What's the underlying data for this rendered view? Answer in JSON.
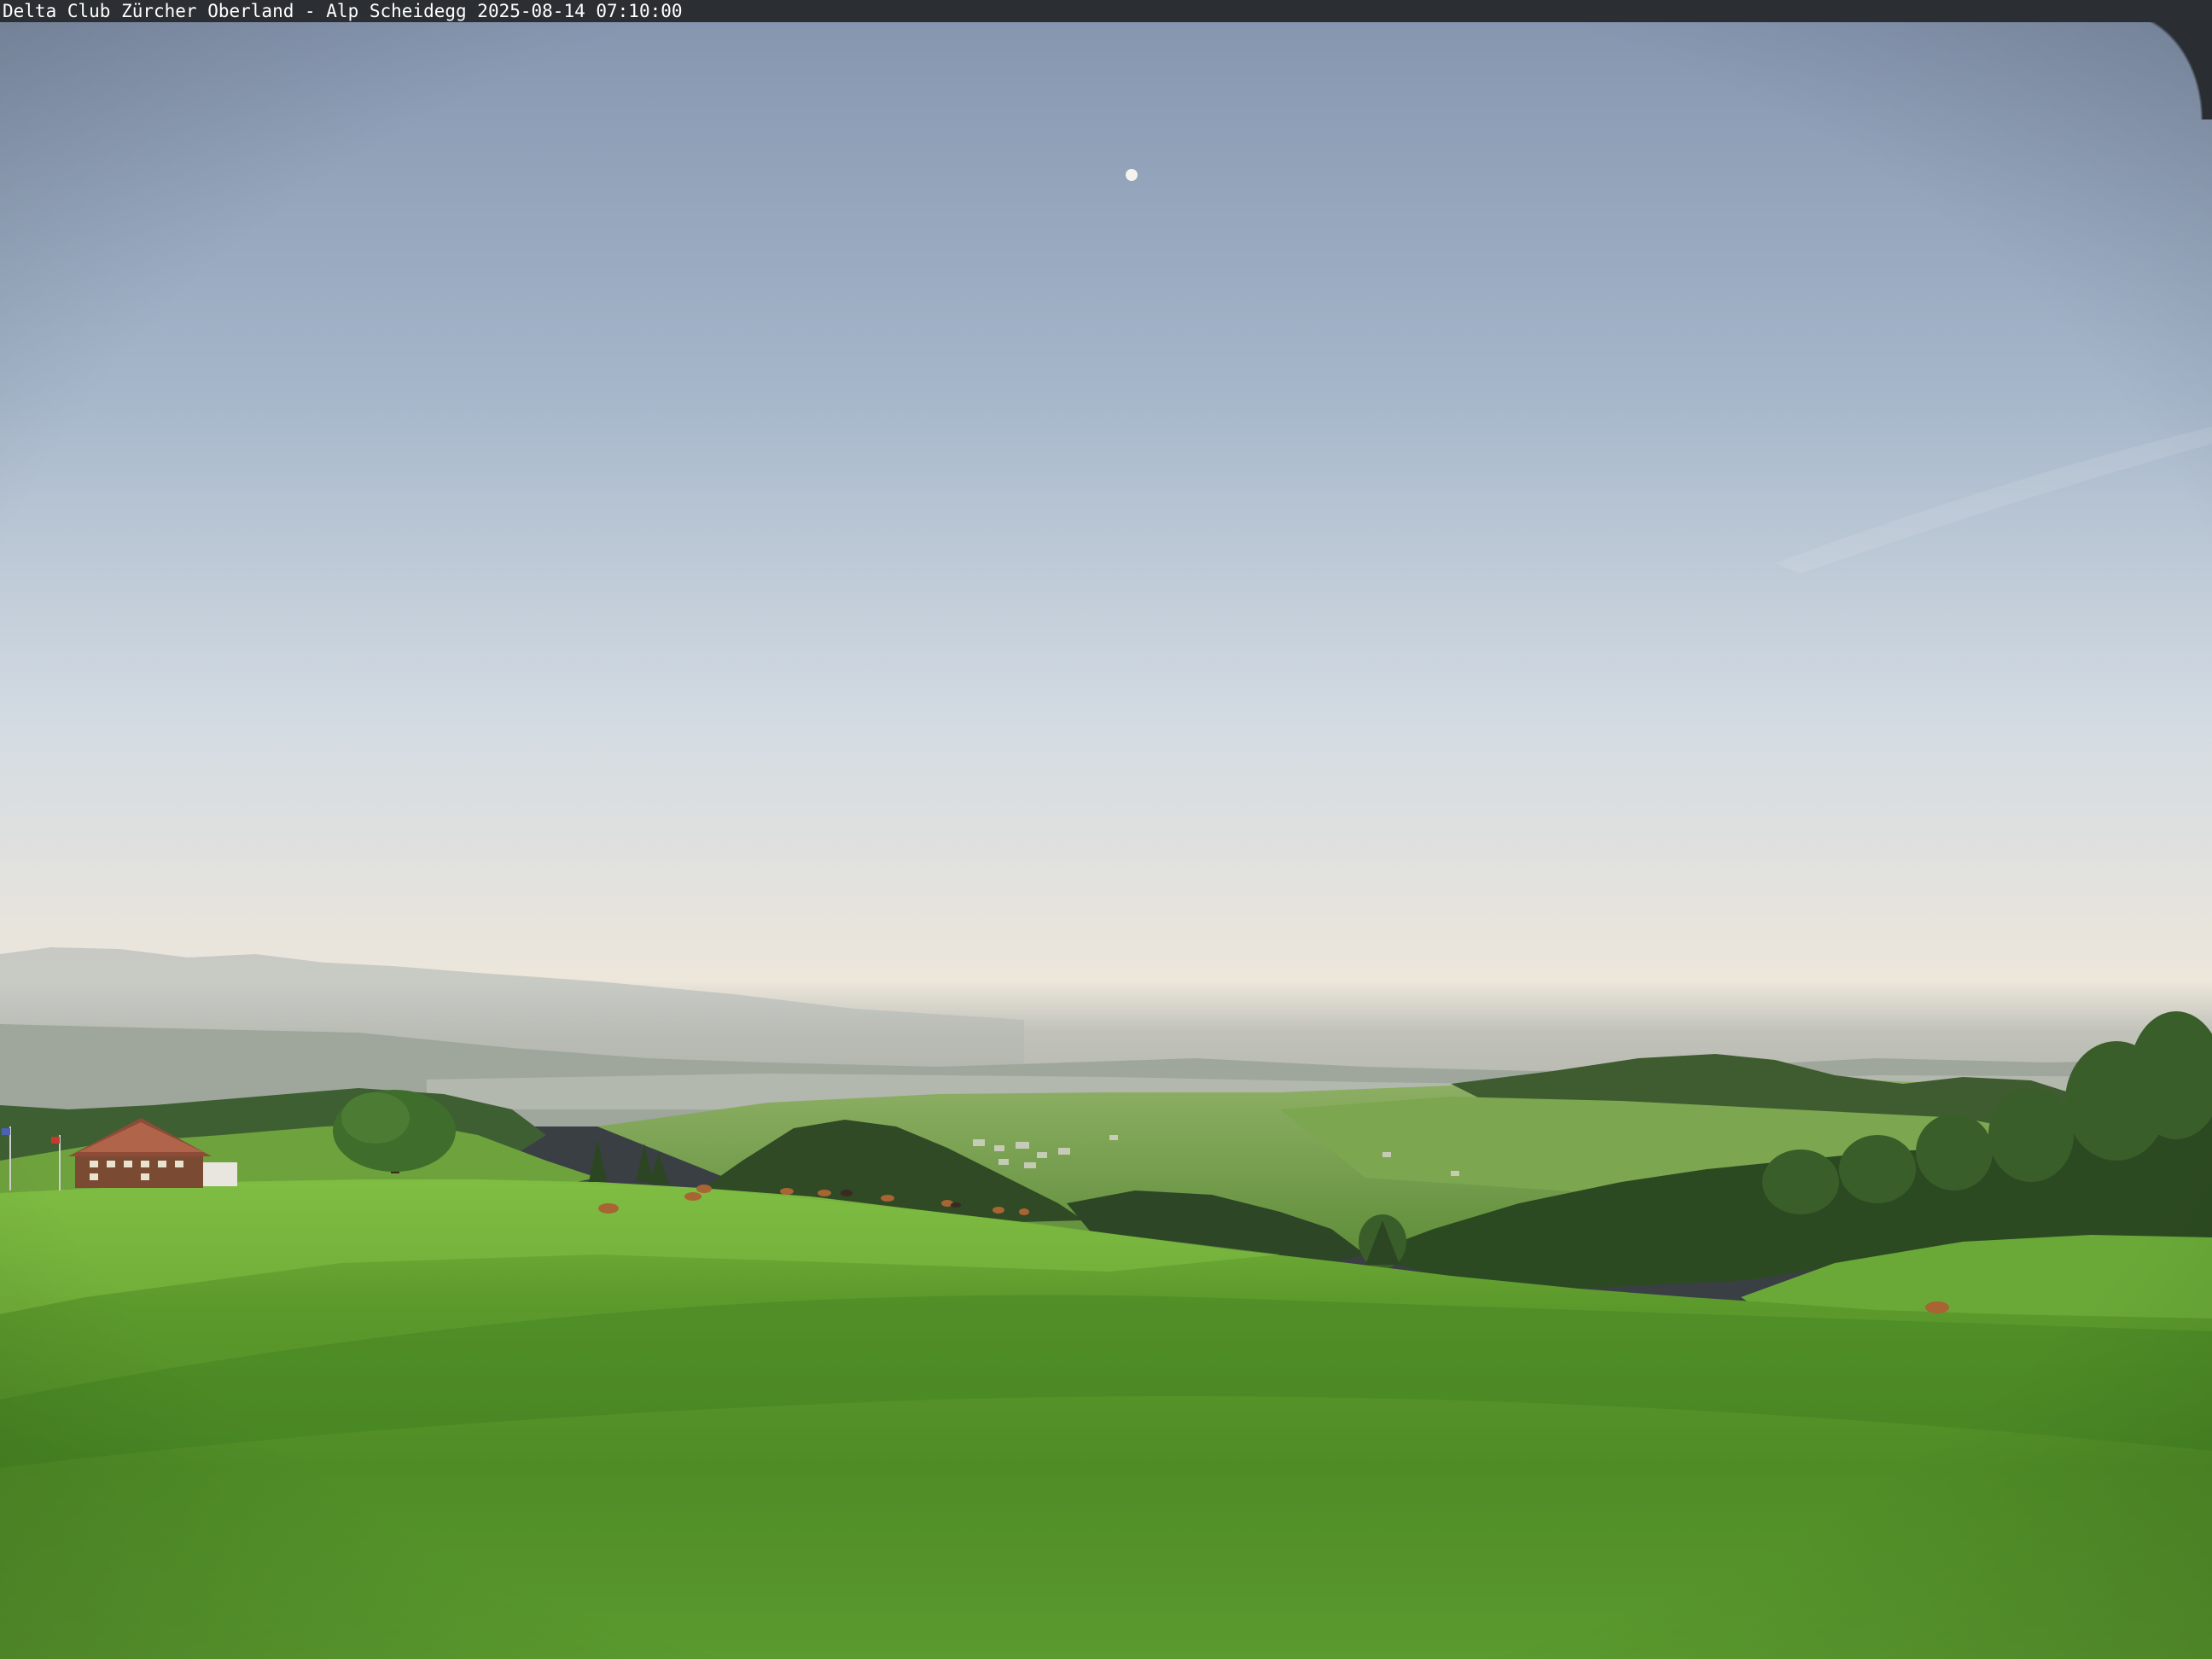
{
  "caption": {
    "text": "Delta Club Zürcher Oberland - Alp Scheidegg 2025-08-14 07:10:00"
  },
  "colors": {
    "sky_top": "#8799b4",
    "sky_mid": "#c3d0de",
    "sky_horizon": "#ece4d6",
    "haze": "#cfcfc6",
    "far_hills": "#9aa39a",
    "meadow_light": "#73b23a",
    "meadow_dark": "#3f7f22",
    "forest": "#2c4a22",
    "caption_bar": "#2b2f33",
    "caption_text": "#ffffff"
  }
}
